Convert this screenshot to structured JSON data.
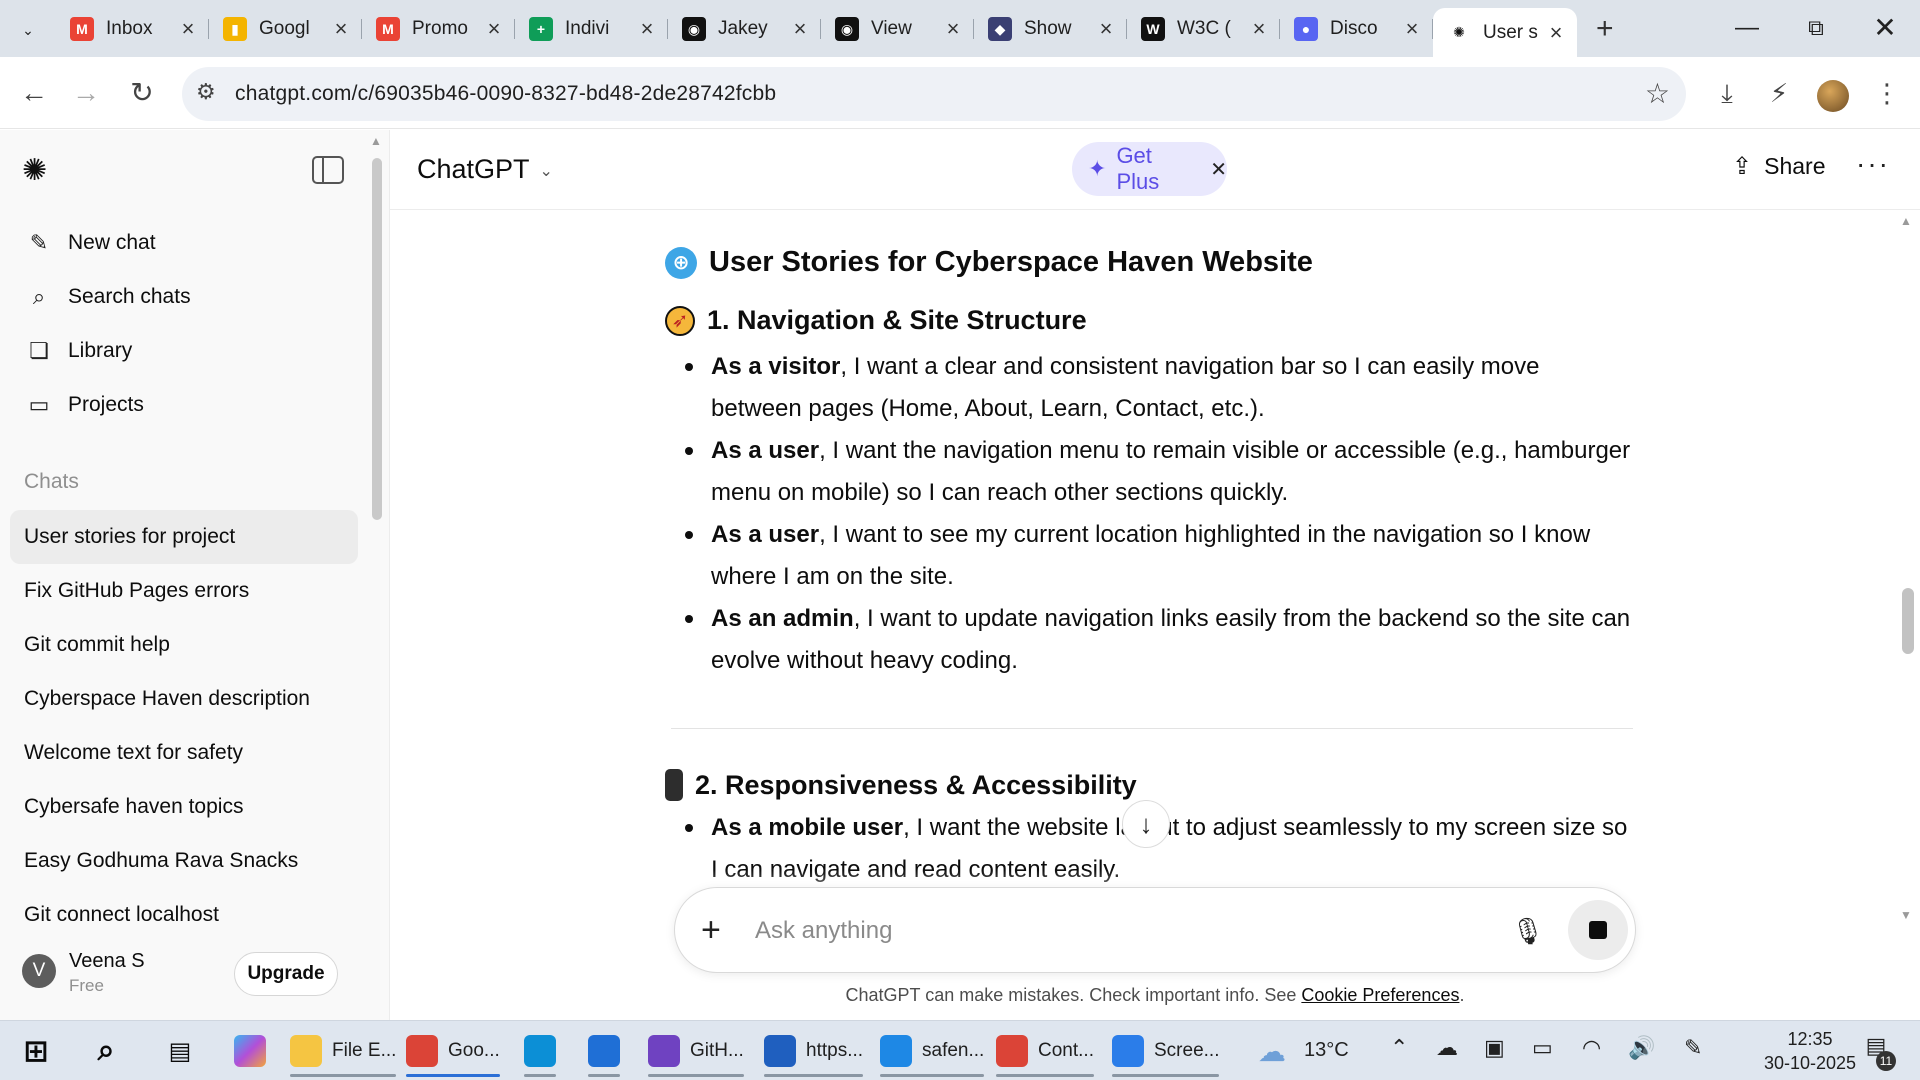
{
  "browser": {
    "tabs": [
      {
        "title": "Inbox",
        "icon": "gmail-icon",
        "color": "#ea4335",
        "glyph": "M",
        "active": false
      },
      {
        "title": "Googl",
        "icon": "google-keep-icon",
        "color": "#f4b400",
        "glyph": "▮",
        "active": false
      },
      {
        "title": "Promo",
        "icon": "gmail-icon",
        "color": "#ea4335",
        "glyph": "M",
        "active": false
      },
      {
        "title": "Indivi",
        "icon": "google-sheets-icon",
        "color": "#0f9d58",
        "glyph": "+",
        "active": false
      },
      {
        "title": "Jakey",
        "icon": "github-icon",
        "color": "#111111",
        "glyph": "◉",
        "active": false
      },
      {
        "title": "View",
        "icon": "github-icon",
        "color": "#111111",
        "glyph": "◉",
        "active": false
      },
      {
        "title": "Show",
        "icon": "wolf-icon",
        "color": "#3a3f73",
        "glyph": "◆",
        "active": false
      },
      {
        "title": "W3C (",
        "icon": "w3c-icon",
        "color": "#111111",
        "glyph": "W",
        "active": false
      },
      {
        "title": "Disco",
        "icon": "discord-icon",
        "color": "#5865f2",
        "glyph": "●",
        "active": false
      },
      {
        "title": "User s",
        "icon": "chatgpt-icon",
        "color": "#ffffff",
        "glyph": "✺",
        "active": true
      }
    ],
    "url": "chatgpt.com/c/69035b46-0090-8327-bd48-2de28742fcbb"
  },
  "sidebar": {
    "menu": [
      {
        "label": "New chat",
        "icon": "new-chat-icon",
        "glyph": "✎"
      },
      {
        "label": "Search chats",
        "icon": "search-icon",
        "glyph": "⌕"
      },
      {
        "label": "Library",
        "icon": "library-icon",
        "glyph": "❏"
      },
      {
        "label": "Projects",
        "icon": "folder-icon",
        "glyph": "▭"
      }
    ],
    "section_label": "Chats",
    "chats": [
      "User stories for project",
      "Fix GitHub Pages errors",
      "Git commit help",
      "Cyberspace Haven description",
      "Welcome text for safety",
      "Cybersafe haven topics",
      "Easy Godhuma Rava Snacks",
      "Git connect localhost"
    ],
    "active_chat_index": 0,
    "user": {
      "initial": "V",
      "name": "Veena S",
      "plan": "Free",
      "upgrade_label": "Upgrade"
    }
  },
  "header": {
    "model": "ChatGPT",
    "get_plus": "Get Plus",
    "share": "Share"
  },
  "conversation": {
    "title": "User Stories for Cyberspace Haven Website",
    "section1": {
      "heading": "1. Navigation & Site Structure",
      "stories": [
        {
          "role": "As a visitor",
          "text": ", I want a clear and consistent navigation bar so I can easily move between pages (Home, About, Learn, Contact, etc.)."
        },
        {
          "role": "As a user",
          "text": ", I want the navigation menu to remain visible or accessible (e.g., hamburger menu on mobile) so I can reach other sections quickly."
        },
        {
          "role": "As a user",
          "text": ", I want to see my current location highlighted in the navigation so I know where I am on the site."
        },
        {
          "role": "As an admin",
          "text": ", I want to update navigation links easily from the backend so the site can evolve without heavy coding."
        }
      ]
    },
    "section2": {
      "heading": "2. Responsiveness & Accessibility",
      "stories": [
        {
          "role": "As a mobile user",
          "text": ", I want the website layout to adjust seamlessly to my screen size so I can navigate and read content easily."
        }
      ]
    }
  },
  "composer": {
    "placeholder": "Ask anything",
    "disclaimer_prefix": "ChatGPT can make mistakes. Check important info. See ",
    "disclaimer_link": "Cookie Preferences",
    "disclaimer_suffix": "."
  },
  "taskbar": {
    "apps": [
      {
        "label": "File E...",
        "icon": "file-explorer-icon",
        "color": "#f5c542"
      },
      {
        "label": "Goo...",
        "icon": "chrome-icon",
        "color": "#db4437"
      },
      {
        "label": "",
        "icon": "edge-icon",
        "color": "#0c8fd6"
      },
      {
        "label": "",
        "icon": "store-icon",
        "color": "#1f6fd6"
      },
      {
        "label": "GitH...",
        "icon": "github-desktop-icon",
        "color": "#6f42c1"
      },
      {
        "label": "https...",
        "icon": "word-icon",
        "color": "#1f5fbf"
      },
      {
        "label": "safen...",
        "icon": "vscode-icon",
        "color": "#1e88e5"
      },
      {
        "label": "Cont...",
        "icon": "chrome-icon",
        "color": "#db4437"
      },
      {
        "label": "Scree...",
        "icon": "snipping-tool-icon",
        "color": "#2b7de9"
      }
    ],
    "weather": "13°C",
    "time": "12:35",
    "date": "30-10-2025",
    "notifications": "11"
  }
}
